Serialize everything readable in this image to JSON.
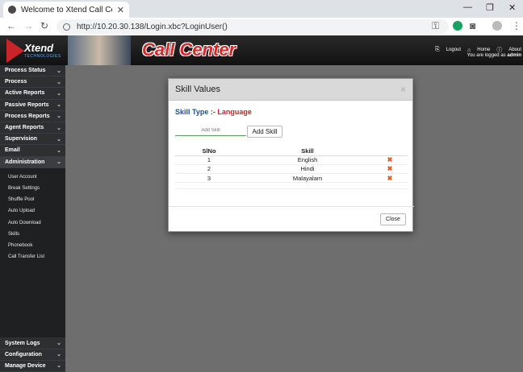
{
  "browser": {
    "tab_title": "Welcome to Xtend Call Center",
    "url": "http://10.20.30.138/Login.xbc?LoginUser()"
  },
  "header": {
    "logo_text": "Xtend",
    "logo_sub": "TECHNOLOGIES",
    "brand": "Call Center",
    "links": [
      "Logout",
      "Home",
      "About"
    ],
    "logged_as_prefix": "You are logged as",
    "logged_user": "admin"
  },
  "sidebar": {
    "top_items": [
      "Process Status",
      "Process",
      "Active Reports",
      "Passive Reports",
      "Process Reports",
      "Agent Reports",
      "Supervision",
      "Email",
      "Administration"
    ],
    "sub_items": [
      "User Account",
      "Break Settings",
      "Shuffle Pool",
      "Auto Upload",
      "Auto Download",
      "Skills",
      "Phonebook",
      "Call Transfer List"
    ],
    "bottom_items": [
      "System Logs",
      "Configuration",
      "Manage Device"
    ]
  },
  "modal": {
    "title": "Skill Values",
    "close_glyph": "×",
    "skill_type_label": "Skill Type :-",
    "skill_type_value": "Language",
    "add_placeholder": "Add Skill",
    "add_button": "Add Skill",
    "columns": [
      "SlNo",
      "Skill"
    ],
    "rows": [
      {
        "slno": "1",
        "skill": "English"
      },
      {
        "slno": "2",
        "skill": "Hindi"
      },
      {
        "slno": "3",
        "skill": "Malayalam"
      }
    ],
    "close_button": "Close"
  },
  "colors": {
    "brand_red": "#d52a2a",
    "skill_type_blue": "#1f4e8c",
    "delete_orange": "#e8571e"
  }
}
